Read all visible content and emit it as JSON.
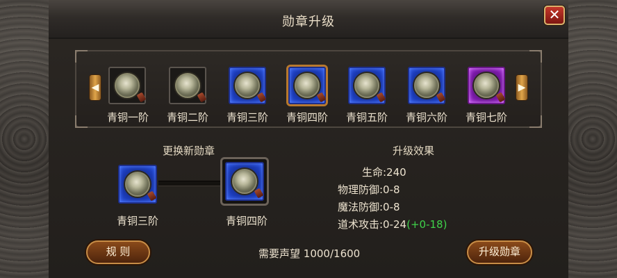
{
  "window": {
    "title": "勋章升级",
    "close_label": "✕"
  },
  "strip": {
    "prev_arrow": "◀",
    "next_arrow": "▶",
    "medals": [
      {
        "label": "青铜一阶",
        "frame": "plain"
      },
      {
        "label": "青铜二阶",
        "frame": "plain"
      },
      {
        "label": "青铜三阶",
        "frame": "blue"
      },
      {
        "label": "青铜四阶",
        "frame": "blue",
        "selected": true
      },
      {
        "label": "青铜五阶",
        "frame": "blue"
      },
      {
        "label": "青铜六阶",
        "frame": "blue"
      },
      {
        "label": "青铜七阶",
        "frame": "purple"
      }
    ]
  },
  "replace": {
    "heading": "更换新勋章",
    "from_label": "青铜三阶",
    "to_label": "青铜四阶"
  },
  "effects": {
    "heading": "升级效果",
    "life": "生命:240",
    "phys_def": "物理防御:0-8",
    "magic_def": "魔法防御:0-8",
    "taoist_atk": "道术攻击:0-24",
    "taoist_atk_bonus": "(+0-18)"
  },
  "footer": {
    "rules_button": "规 则",
    "upgrade_button": "升级勋章",
    "cost_label": "需要声望",
    "cost_value": "1000/1600"
  },
  "colors": {
    "accent_gold": "#c88d46",
    "bonus_green": "#3fd24a",
    "close_red": "#c3372a"
  }
}
